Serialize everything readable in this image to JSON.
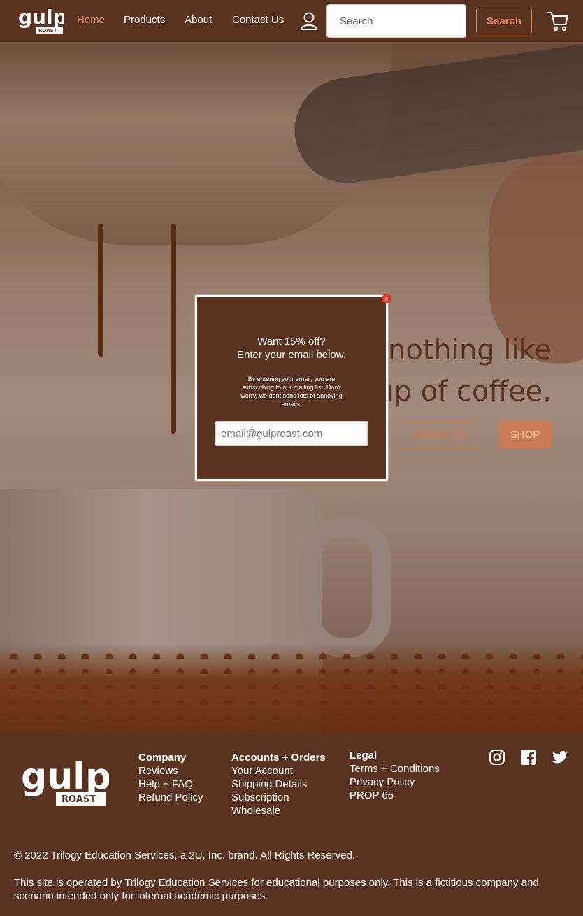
{
  "header": {
    "logo_text": "gulp",
    "logo_subtext": "ROAST",
    "nav": [
      "Home",
      "Products",
      "About",
      "Contact Us"
    ],
    "search_placeholder": "Search",
    "search_button": "Search",
    "icons": [
      "user-icon",
      "cart-icon"
    ],
    "accent_color": "#e3895e"
  },
  "hero": {
    "heading_line1": "nothing like",
    "heading_line2": "up of coffee.",
    "about_button": "ABOUT US",
    "shop_button": "SHOP"
  },
  "modal": {
    "close_label": "x",
    "title_line1": "Want 15% off?",
    "title_line2": "Enter your email below.",
    "note": "By entering your email, you are subscribing to our mailing list. Don't worry, we dont send lots of annoying emails.",
    "email_placeholder": "email@gulproast.com"
  },
  "footer": {
    "company": {
      "heading": "Company",
      "links": [
        "Reviews",
        "Help + FAQ",
        "Refund Policy"
      ]
    },
    "accounts": {
      "heading": "Accounts + Orders",
      "links": [
        "Your Account",
        "Shipping Details",
        "Subscription",
        "Wholesale"
      ]
    },
    "legal": {
      "heading": "Legal",
      "links": [
        "Terms + Conditions",
        "Privacy Policy",
        "PROP 65"
      ]
    },
    "social": [
      "instagram-icon",
      "facebook-icon",
      "twitter-icon"
    ],
    "copyright": "© 2022 Trilogy Education Services, a 2U, Inc. brand. All Rights Reserved.",
    "disclaimer": "This site is operated by Trilogy Education Services for educational purposes only. This is a fictitious company and scenario intended only for internal academic purposes."
  },
  "colors": {
    "brand_brown": "#5a3320",
    "accent": "#e3895e",
    "close_red": "#d43a2f"
  }
}
